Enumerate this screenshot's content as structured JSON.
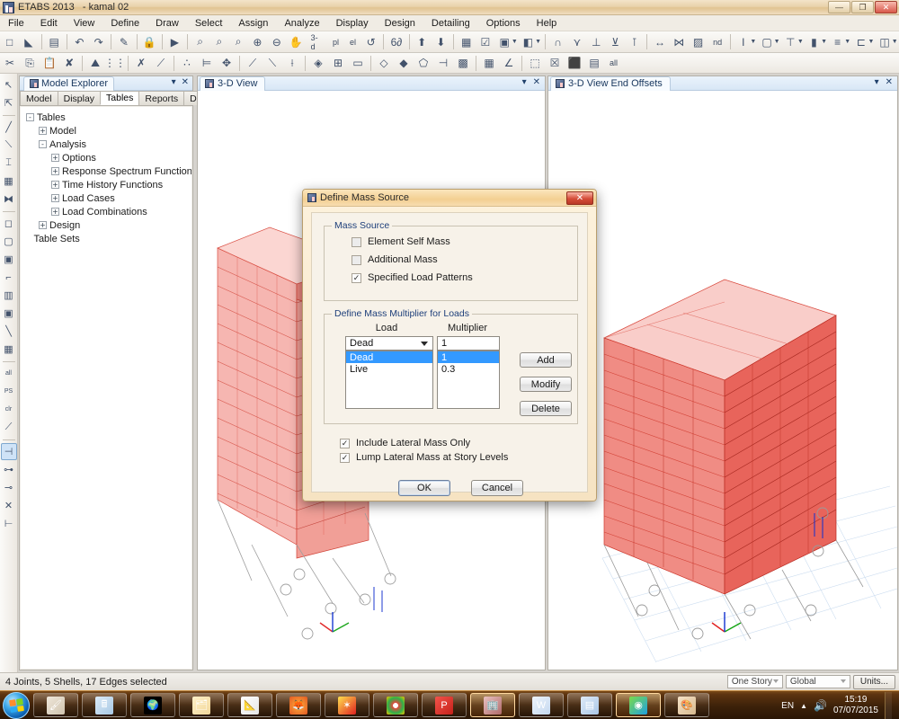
{
  "window": {
    "app_title": "ETABS 2013",
    "project_name": "- kamal 02",
    "icon": "etabs-icon",
    "minimize": "—",
    "maximize": "❐",
    "close": "✕"
  },
  "menubar": {
    "items": [
      {
        "label": "File"
      },
      {
        "label": "Edit"
      },
      {
        "label": "View"
      },
      {
        "label": "Define"
      },
      {
        "label": "Draw"
      },
      {
        "label": "Select"
      },
      {
        "label": "Assign"
      },
      {
        "label": "Analyze"
      },
      {
        "label": "Display"
      },
      {
        "label": "Design"
      },
      {
        "label": "Detailing"
      },
      {
        "label": "Options"
      },
      {
        "label": "Help"
      }
    ]
  },
  "toolbar_main": {
    "items": [
      {
        "name": "new-model-icon",
        "glyph": "□"
      },
      {
        "name": "open-model-icon",
        "glyph": "◣"
      },
      {
        "sep": true
      },
      {
        "name": "save-icon",
        "glyph": "▤"
      },
      {
        "sep": true
      },
      {
        "name": "undo-icon",
        "glyph": "↶"
      },
      {
        "name": "redo-icon",
        "glyph": "↷"
      },
      {
        "sep": true
      },
      {
        "name": "edit-pencil-icon",
        "glyph": "✎"
      },
      {
        "sep": true
      },
      {
        "name": "lock-model-icon",
        "glyph": "🔒"
      },
      {
        "sep": true
      },
      {
        "name": "run-analysis-icon",
        "glyph": "▶"
      },
      {
        "sep": true
      },
      {
        "name": "zoom-region-icon",
        "glyph": "⌕"
      },
      {
        "name": "zoom-previous-icon",
        "glyph": "⌕"
      },
      {
        "name": "zoom-full-icon",
        "glyph": "⌕"
      },
      {
        "name": "zoom-in-icon",
        "glyph": "⊕"
      },
      {
        "name": "zoom-out-icon",
        "glyph": "⊖"
      },
      {
        "name": "pan-icon",
        "glyph": "✋"
      },
      {
        "name": "view-3d-button",
        "text": "3-d"
      },
      {
        "name": "view-plan-button",
        "text": "pl"
      },
      {
        "name": "view-elevation-button",
        "text": "el"
      },
      {
        "name": "rotate-view-icon",
        "glyph": "↺"
      },
      {
        "sep": true
      },
      {
        "name": "perspective-toggle-icon",
        "glyph": "6∂"
      },
      {
        "sep": true
      },
      {
        "name": "story-up-icon",
        "glyph": "⬆"
      },
      {
        "name": "story-down-icon",
        "glyph": "⬇"
      },
      {
        "sep": true
      },
      {
        "name": "set-display-options-icon",
        "glyph": "▦"
      },
      {
        "name": "object-assign-toggle-icon",
        "glyph": "☑"
      },
      {
        "name": "extrude-view-icon",
        "glyph": "▣"
      },
      {
        "caret": true
      },
      {
        "name": "shrink-objects-icon",
        "glyph": "◧"
      },
      {
        "caret": true
      },
      {
        "sep": true
      },
      {
        "name": "show-undeformed-icon",
        "glyph": "∩"
      },
      {
        "name": "show-deformed-icon",
        "glyph": "⋎"
      },
      {
        "name": "show-forces-icon",
        "glyph": "⊥"
      },
      {
        "name": "show-moments-icon",
        "glyph": "⊻"
      },
      {
        "name": "show-reactions-icon",
        "glyph": "⊺"
      },
      {
        "sep": true
      },
      {
        "name": "frame-releases-icon",
        "glyph": "↔"
      },
      {
        "name": "end-offsets-icon",
        "glyph": "⋈"
      },
      {
        "name": "section-cut-icon",
        "glyph": "▨"
      },
      {
        "name": "nd-display-button",
        "text": "nd"
      },
      {
        "sep": true
      },
      {
        "name": "draw-beam-icon",
        "glyph": "I"
      },
      {
        "caret": true
      },
      {
        "name": "draw-floor-icon",
        "glyph": "▢"
      },
      {
        "caret": true
      },
      {
        "name": "draw-column-icon",
        "glyph": "⊤"
      },
      {
        "caret": true
      },
      {
        "name": "draw-brace-icon",
        "glyph": "▮"
      },
      {
        "caret": true
      },
      {
        "name": "draw-secondary-beam-icon",
        "glyph": "≡"
      },
      {
        "caret": true
      },
      {
        "name": "draw-wall-icon",
        "glyph": "⊏"
      },
      {
        "caret": true
      },
      {
        "name": "draw-opening-icon",
        "glyph": "◫"
      },
      {
        "caret": true
      }
    ]
  },
  "toolbar_edit": {
    "items": [
      {
        "name": "cut-icon",
        "glyph": "✂"
      },
      {
        "name": "copy-icon",
        "glyph": "⎘"
      },
      {
        "name": "paste-icon",
        "glyph": "📋"
      },
      {
        "name": "delete-icon",
        "glyph": "✘"
      },
      {
        "sep": true
      },
      {
        "name": "edit-stories-icon",
        "glyph": "⛰"
      },
      {
        "name": "edit-grid-icon",
        "glyph": "⋮⋮"
      },
      {
        "sep": true
      },
      {
        "name": "move-points-icon",
        "glyph": "✗"
      },
      {
        "name": "merge-points-icon",
        "glyph": "⟋"
      },
      {
        "sep": true
      },
      {
        "name": "align-points-icon",
        "glyph": "∴"
      },
      {
        "name": "align-edges-icon",
        "glyph": "⊨"
      },
      {
        "name": "move-objects-icon",
        "glyph": "✥"
      },
      {
        "sep": true
      },
      {
        "name": "divide-frames-icon",
        "glyph": "⟋"
      },
      {
        "name": "join-frames-icon",
        "glyph": "⟍"
      },
      {
        "name": "trim-frames-icon",
        "glyph": "⟊"
      },
      {
        "sep": true
      },
      {
        "name": "divide-shells-icon",
        "glyph": "◈"
      },
      {
        "name": "merge-shells-icon",
        "glyph": "⊞"
      },
      {
        "name": "expand-shell-icon",
        "glyph": "▭"
      },
      {
        "sep": true
      },
      {
        "name": "extrude-point-to-frame-icon",
        "glyph": "◇"
      },
      {
        "name": "extrude-frame-to-shell-icon",
        "glyph": "◆"
      },
      {
        "name": "extrude-shell-to-solid-icon",
        "glyph": "⬠"
      },
      {
        "name": "mirror-icon",
        "glyph": "⊣"
      },
      {
        "name": "replicate-icon",
        "glyph": "▩"
      },
      {
        "sep": true
      },
      {
        "name": "select-by-grid-icon",
        "glyph": "▦"
      },
      {
        "name": "select-intersecting-icon",
        "glyph": "∠"
      },
      {
        "sep": true
      },
      {
        "name": "select-window-icon",
        "glyph": "⬚"
      },
      {
        "name": "deselect-icon",
        "glyph": "☒"
      },
      {
        "name": "select-previous-icon",
        "glyph": "⬛"
      },
      {
        "name": "select-invert-icon",
        "glyph": "▤"
      },
      {
        "name": "select-all-button",
        "text": "all"
      }
    ]
  },
  "left_toolbar": {
    "items": [
      {
        "name": "pointer-select-icon",
        "glyph": "↖",
        "active": false
      },
      {
        "name": "reshape-object-icon",
        "glyph": "⇱",
        "active": false
      },
      {
        "sep": true
      },
      {
        "name": "draw-line-icon",
        "glyph": "╱",
        "active": false
      },
      {
        "name": "quick-draw-beam-icon",
        "glyph": "⟍",
        "active": false
      },
      {
        "name": "quick-draw-column-icon",
        "glyph": "⌶",
        "active": false
      },
      {
        "name": "quick-draw-brace-icon",
        "glyph": "▦",
        "active": false
      },
      {
        "name": "quick-draw-secondary-beams-icon",
        "glyph": "⧓",
        "active": false
      },
      {
        "sep": true
      },
      {
        "name": "draw-floor-poly-icon",
        "glyph": "◻",
        "active": false
      },
      {
        "name": "draw-rect-floor-icon",
        "glyph": "▢",
        "active": false
      },
      {
        "name": "quick-draw-floor-icon",
        "glyph": "▣",
        "active": false
      },
      {
        "name": "draw-wall-icon",
        "glyph": "⌐",
        "active": false
      },
      {
        "name": "quick-draw-wall-icon",
        "glyph": "▥",
        "active": false
      },
      {
        "name": "draw-opening-icon",
        "glyph": "▣",
        "active": false
      },
      {
        "name": "draw-reference-line-icon",
        "glyph": "╲",
        "active": false
      },
      {
        "name": "draw-dimension-icon",
        "glyph": "▦",
        "active": false
      },
      {
        "sep": true
      },
      {
        "name": "select-all-icon",
        "glyph": "all",
        "active": false
      },
      {
        "name": "select-previous-selection-icon",
        "glyph": "PS",
        "active": false
      },
      {
        "name": "clear-selection-icon",
        "glyph": "clr",
        "active": false
      },
      {
        "name": "select-by-line-icon",
        "glyph": "⟋",
        "active": false
      },
      {
        "sep": true
      },
      {
        "name": "snap-to-point-icon",
        "glyph": "⊣",
        "active": true
      },
      {
        "name": "snap-to-midpoint-icon",
        "glyph": "⊶",
        "active": false
      },
      {
        "name": "snap-to-perpendicular-icon",
        "glyph": "⊸",
        "active": false
      },
      {
        "name": "snap-to-intersection-icon",
        "glyph": "✕",
        "active": false
      },
      {
        "name": "snap-to-nearest-icon",
        "glyph": "⊢",
        "active": false
      }
    ]
  },
  "explorer": {
    "title": "Model Explorer",
    "icon": "model-explorer-icon",
    "menu_caret": "▾",
    "close": "✕",
    "tabs": [
      {
        "label": "Model",
        "selected": false
      },
      {
        "label": "Display",
        "selected": false
      },
      {
        "label": "Tables",
        "selected": true
      },
      {
        "label": "Reports",
        "selected": false
      },
      {
        "label": "Detailing",
        "selected": false
      }
    ],
    "tree": [
      {
        "label": "Tables",
        "indent": 0,
        "expander": "-"
      },
      {
        "label": "Model",
        "indent": 1,
        "expander": "+"
      },
      {
        "label": "Analysis",
        "indent": 1,
        "expander": "-"
      },
      {
        "label": "Options",
        "indent": 2,
        "expander": "+"
      },
      {
        "label": "Response Spectrum Functions",
        "indent": 2,
        "expander": "+"
      },
      {
        "label": "Time History Functions",
        "indent": 2,
        "expander": "+"
      },
      {
        "label": "Load Cases",
        "indent": 2,
        "expander": "+"
      },
      {
        "label": "Load Combinations",
        "indent": 2,
        "expander": "+"
      },
      {
        "label": "Design",
        "indent": 1,
        "expander": "+"
      },
      {
        "label": "Table Sets",
        "indent": 0,
        "expander": ""
      }
    ]
  },
  "views": [
    {
      "title": "3-D View",
      "icon": "view-icon",
      "menu_caret": "▾",
      "close": "✕"
    },
    {
      "title": "3-D View  End Offsets",
      "icon": "view-icon",
      "menu_caret": "▾",
      "close": "✕"
    }
  ],
  "dialog": {
    "title": "Define Mass Source",
    "icon": "etabs-dialog-icon",
    "close": "✕",
    "mass_source": {
      "legend": "Mass Source",
      "options": [
        {
          "label": "Element Self Mass",
          "checked": false
        },
        {
          "label": "Additional Mass",
          "checked": false
        },
        {
          "label": "Specified Load Patterns",
          "checked": true
        }
      ]
    },
    "multiplier": {
      "legend": "Define Mass Multiplier for Loads",
      "col_load": "Load",
      "col_multiplier": "Multiplier",
      "selected_load": "Dead",
      "selected_multiplier": "1",
      "load_rows": [
        {
          "label": "Dead",
          "selected": true
        },
        {
          "label": "Live",
          "selected": false
        }
      ],
      "multiplier_rows": [
        {
          "label": "1",
          "selected": true
        },
        {
          "label": "0.3",
          "selected": false
        }
      ],
      "buttons": [
        {
          "label": "Add",
          "name": "add-button"
        },
        {
          "label": "Modify",
          "name": "modify-button"
        },
        {
          "label": "Delete",
          "name": "delete-button"
        }
      ]
    },
    "extra_options": [
      {
        "label": "Include Lateral Mass Only",
        "checked": true
      },
      {
        "label": "Lump Lateral Mass at Story Levels",
        "checked": true
      }
    ],
    "ok_label": "OK",
    "cancel_label": "Cancel"
  },
  "statusbar": {
    "message": "4 Joints, 5 Shells, 17 Edges selected",
    "story_selector": "One Story",
    "coord_selector": "Global",
    "units_button": "Units..."
  },
  "taskbar": {
    "start": "start-orb",
    "items": [
      {
        "name": "taskbar-item-paint-tool",
        "icon": "brush-icon",
        "active": false
      },
      {
        "name": "taskbar-item-calculator",
        "icon": "calculator-icon",
        "active": false
      },
      {
        "name": "taskbar-item-globe",
        "icon": "globe-icon",
        "active": false
      },
      {
        "name": "taskbar-item-explorer",
        "icon": "folder-icon",
        "active": false
      },
      {
        "name": "taskbar-item-autocad",
        "icon": "autocad-icon",
        "active": false
      },
      {
        "name": "taskbar-item-firefox",
        "icon": "firefox-icon",
        "active": false
      },
      {
        "name": "taskbar-item-ultraiso",
        "icon": "star-icon",
        "active": false
      },
      {
        "name": "taskbar-item-chrome",
        "icon": "chrome-icon",
        "active": false
      },
      {
        "name": "taskbar-item-pdf",
        "icon": "pdf-icon",
        "active": false
      },
      {
        "name": "taskbar-item-etabs",
        "icon": "etabs-icon",
        "active": true
      },
      {
        "name": "taskbar-item-word",
        "icon": "word-icon",
        "active": false
      },
      {
        "name": "taskbar-item-powerpoint",
        "icon": "ppt-icon",
        "active": false
      },
      {
        "name": "taskbar-item-media-player",
        "icon": "media-icon",
        "active": true
      },
      {
        "name": "taskbar-item-paint",
        "icon": "palette-icon",
        "active": false
      }
    ],
    "tray": {
      "language": "EN",
      "show_hidden": "▲",
      "volume": "🔊",
      "time": "15:19",
      "date": "07/07/2015"
    }
  },
  "colors": {
    "model_red": "#e23b2e",
    "model_red_light": "#f08c84",
    "dialog_gold": "#f3cf92",
    "selection_blue": "#3399ff",
    "taskbar_brown": "#5d3410"
  }
}
